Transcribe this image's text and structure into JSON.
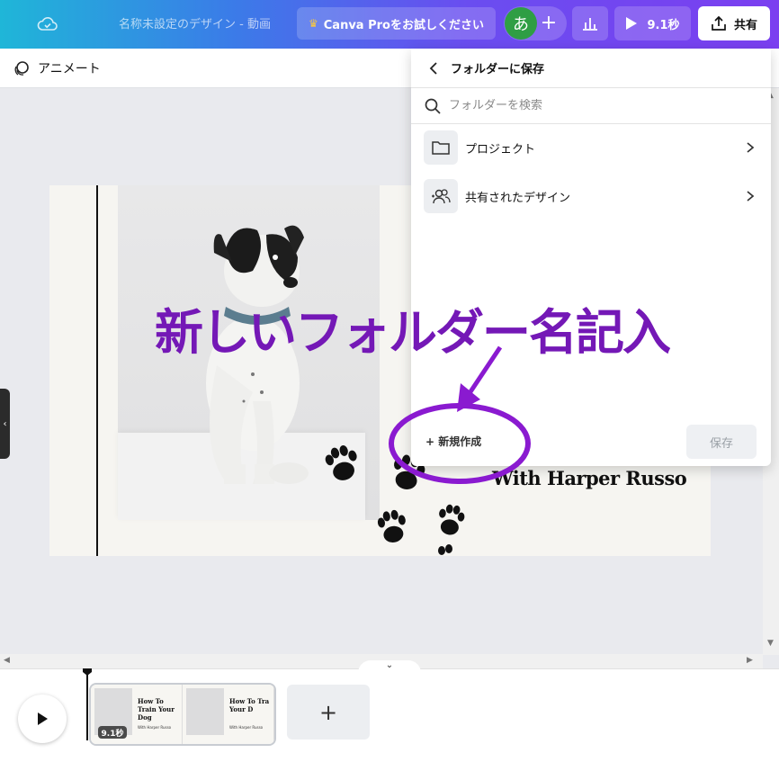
{
  "topbar": {
    "title": "名称未設定のデザイン - 動画",
    "pro_label": "Canva Proをお試しください",
    "avatar_initial": "あ",
    "play_label": "9.1秒",
    "share_label": "共有",
    "gradient": [
      "#1fb6d8",
      "#6a4df0"
    ]
  },
  "subbar": {
    "animate_label": "アニメート"
  },
  "design": {
    "byline": "With Harper Russo"
  },
  "folder_panel": {
    "title": "フォルダーに保存",
    "search_placeholder": "フォルダーを検索",
    "folders": [
      {
        "label": "プロジェクト",
        "icon": "folder-icon"
      },
      {
        "label": "共有されたデザイン",
        "icon": "shared-users-icon"
      }
    ],
    "new_label": "+ 新規作成",
    "save_label": "保存"
  },
  "annotation": {
    "text": "新しいフォルダー名記入",
    "color": "#7418b6"
  },
  "timeline": {
    "clip_duration": "9.1秒",
    "thumb_title_1": "How To Train Your Dog",
    "thumb_title_2": "How To Tra Your D",
    "thumb_byline": "With Harper Russo",
    "add_label": "+"
  }
}
